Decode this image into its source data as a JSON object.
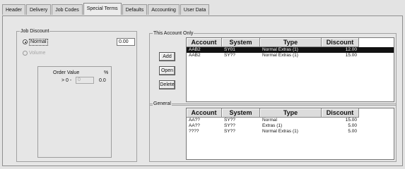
{
  "tabs": [
    "Header",
    "Delivery",
    "Job Codes",
    "Special Terms",
    "Defaults",
    "Accounting",
    "User Data"
  ],
  "active_tab": "Special Terms",
  "job_discount": {
    "title": "Job Discount",
    "normal_label": "Normal",
    "normal_value": "0.00",
    "volume_label": "Volume",
    "order_value_label": "Order Value",
    "percent_label": "%",
    "range_prefix": "> 0 -",
    "range_value": "0",
    "range_percent": "0.0"
  },
  "this_account_only": {
    "title": "This Account Only",
    "buttons": {
      "add": "Add",
      "open": "Open",
      "delete": "Delete"
    },
    "columns": [
      "Account",
      "System",
      "Type",
      "Discount"
    ],
    "rows": [
      {
        "account": "AAB2",
        "system": "SY01",
        "type": "Normal Extras (1)",
        "discount": "12.00",
        "selected": true
      },
      {
        "account": "AAB2",
        "system": "SY??",
        "type": "Normal Extras (1)",
        "discount": "15.00",
        "selected": false
      }
    ]
  },
  "general": {
    "title": "General",
    "columns": [
      "Account",
      "System",
      "Type",
      "Discount"
    ],
    "rows": [
      {
        "account": "AA??",
        "system": "SY??",
        "type": "Normal",
        "discount": "15.00"
      },
      {
        "account": "AA??",
        "system": "SY??",
        "type": "Extras (1)",
        "discount": "5.00"
      },
      {
        "account": "????",
        "system": "SY??",
        "type": "Normal Extras (1)",
        "discount": "5.00"
      }
    ]
  }
}
